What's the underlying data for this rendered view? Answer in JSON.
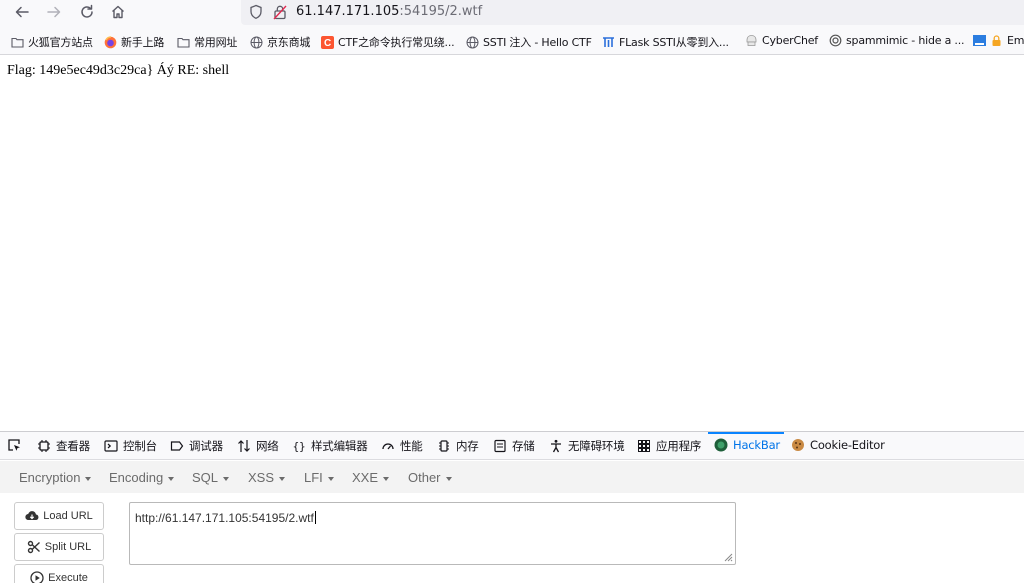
{
  "browser": {
    "url_host": "61.147.171.105",
    "url_rest": ":54195/2.wtf",
    "bookmarks": [
      {
        "label": "火狐官方站点",
        "icon": "folder-icon"
      },
      {
        "label": "新手上路",
        "icon": "firefox-icon"
      },
      {
        "label": "常用网址",
        "icon": "folder-icon"
      },
      {
        "label": "京东商城",
        "icon": "globe-icon"
      },
      {
        "label": "CTF之命令执行常见绕...",
        "icon": "csdn-icon"
      },
      {
        "label": "SSTI 注入 - Hello CTF",
        "icon": "globe-icon"
      },
      {
        "label": "FLask SSTI从零到入...",
        "icon": "site-icon"
      },
      {
        "label": "CyberChef",
        "icon": "cyberchef-icon"
      },
      {
        "label": "spammimic - hide a ...",
        "icon": "spammimic-icon"
      },
      {
        "label": "Em",
        "icon": "lock-icon"
      }
    ]
  },
  "page": {
    "content": "Flag: 149e5ec49d3c29ca} Áý RE: shell"
  },
  "devtools": {
    "tabs": [
      "查看器",
      "控制台",
      "调试器",
      "网络",
      "样式编辑器",
      "性能",
      "内存",
      "存储",
      "无障碍环境",
      "应用程序",
      "HackBar",
      "Cookie-Editor"
    ],
    "active_tab": "HackBar"
  },
  "hackbar": {
    "menu": [
      "Encryption",
      "Encoding",
      "SQL",
      "XSS",
      "LFI",
      "XXE",
      "Other"
    ],
    "buttons": {
      "load": "Load URL",
      "split": "Split URL",
      "execute": "Execute"
    },
    "url_value": "http://61.147.171.105:54195/2.wtf"
  }
}
